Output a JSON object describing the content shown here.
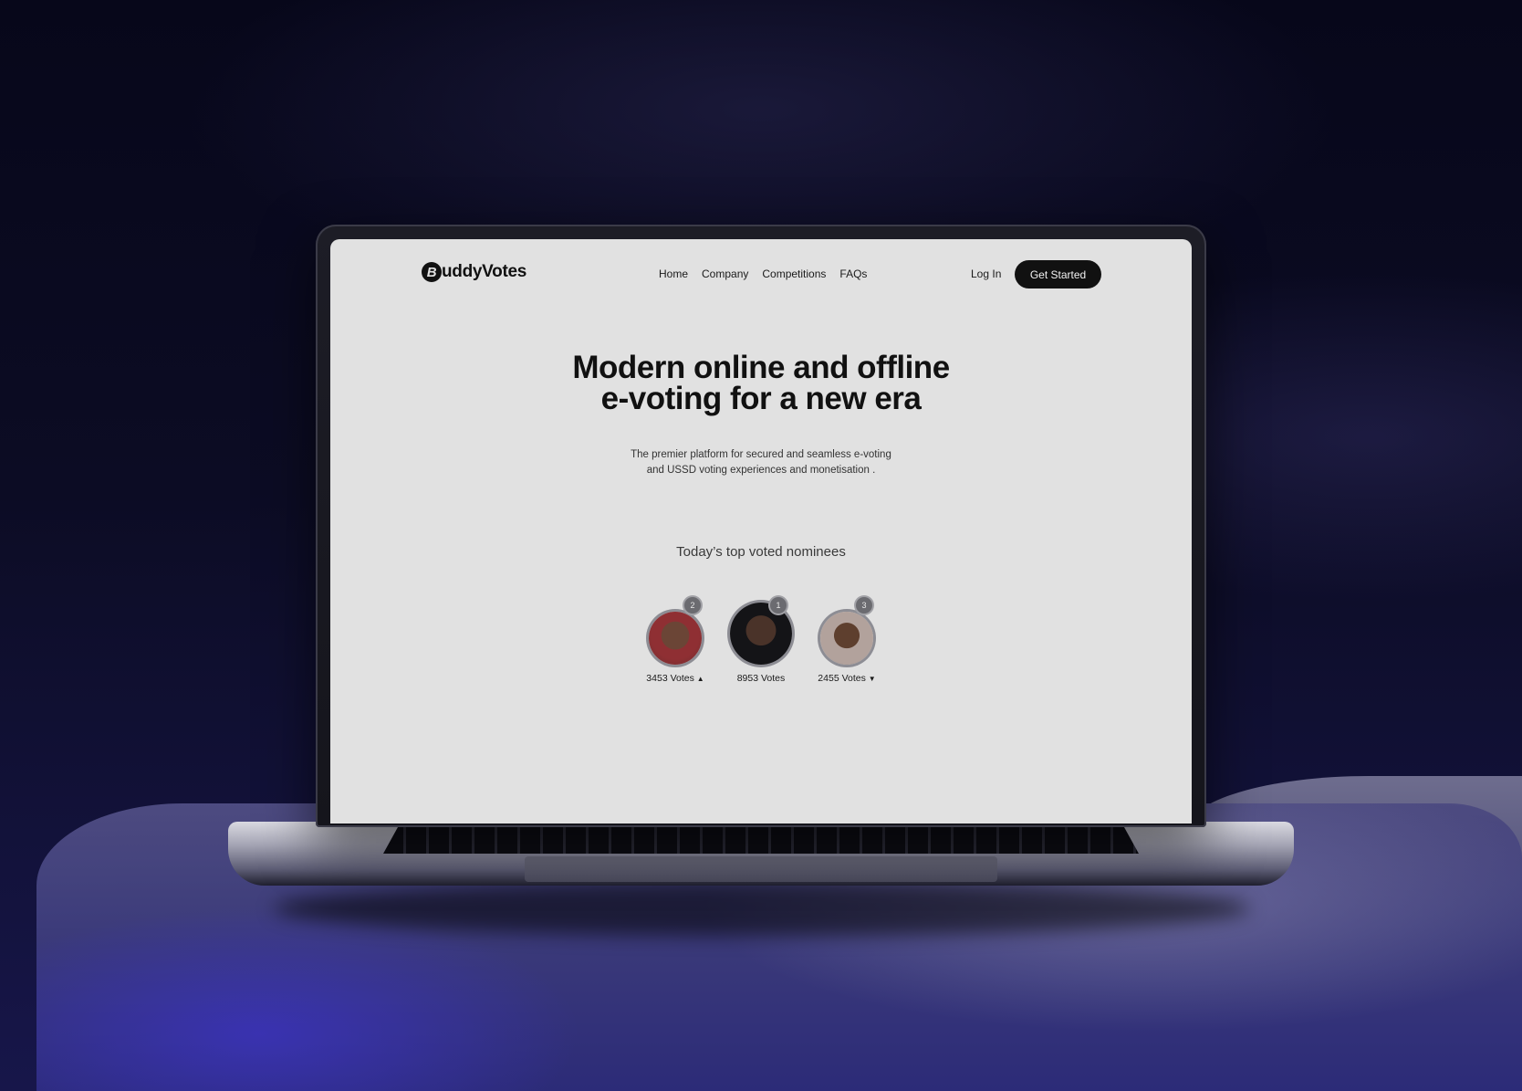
{
  "brand": {
    "logo_mark": "B",
    "name": "uddyVotes"
  },
  "nav": {
    "links": [
      "Home",
      "Company",
      "Competitions",
      "FAQs"
    ],
    "login": "Log In",
    "cta": "Get Started"
  },
  "hero": {
    "title_line1": "Modern online and offline",
    "title_line2": "e-voting for a new era",
    "subtitle_line1": "The premier platform for secured and seamless e-voting",
    "subtitle_line2": "and USSD voting experiences and monetisation ."
  },
  "nominees": {
    "title": "Today’s top voted nominees",
    "items": [
      {
        "rank": "2",
        "votes": "3453 Votes",
        "trend": "▲"
      },
      {
        "rank": "1",
        "votes": "8953 Votes",
        "trend": ""
      },
      {
        "rank": "3",
        "votes": "2455 Votes",
        "trend": "▼"
      }
    ]
  }
}
